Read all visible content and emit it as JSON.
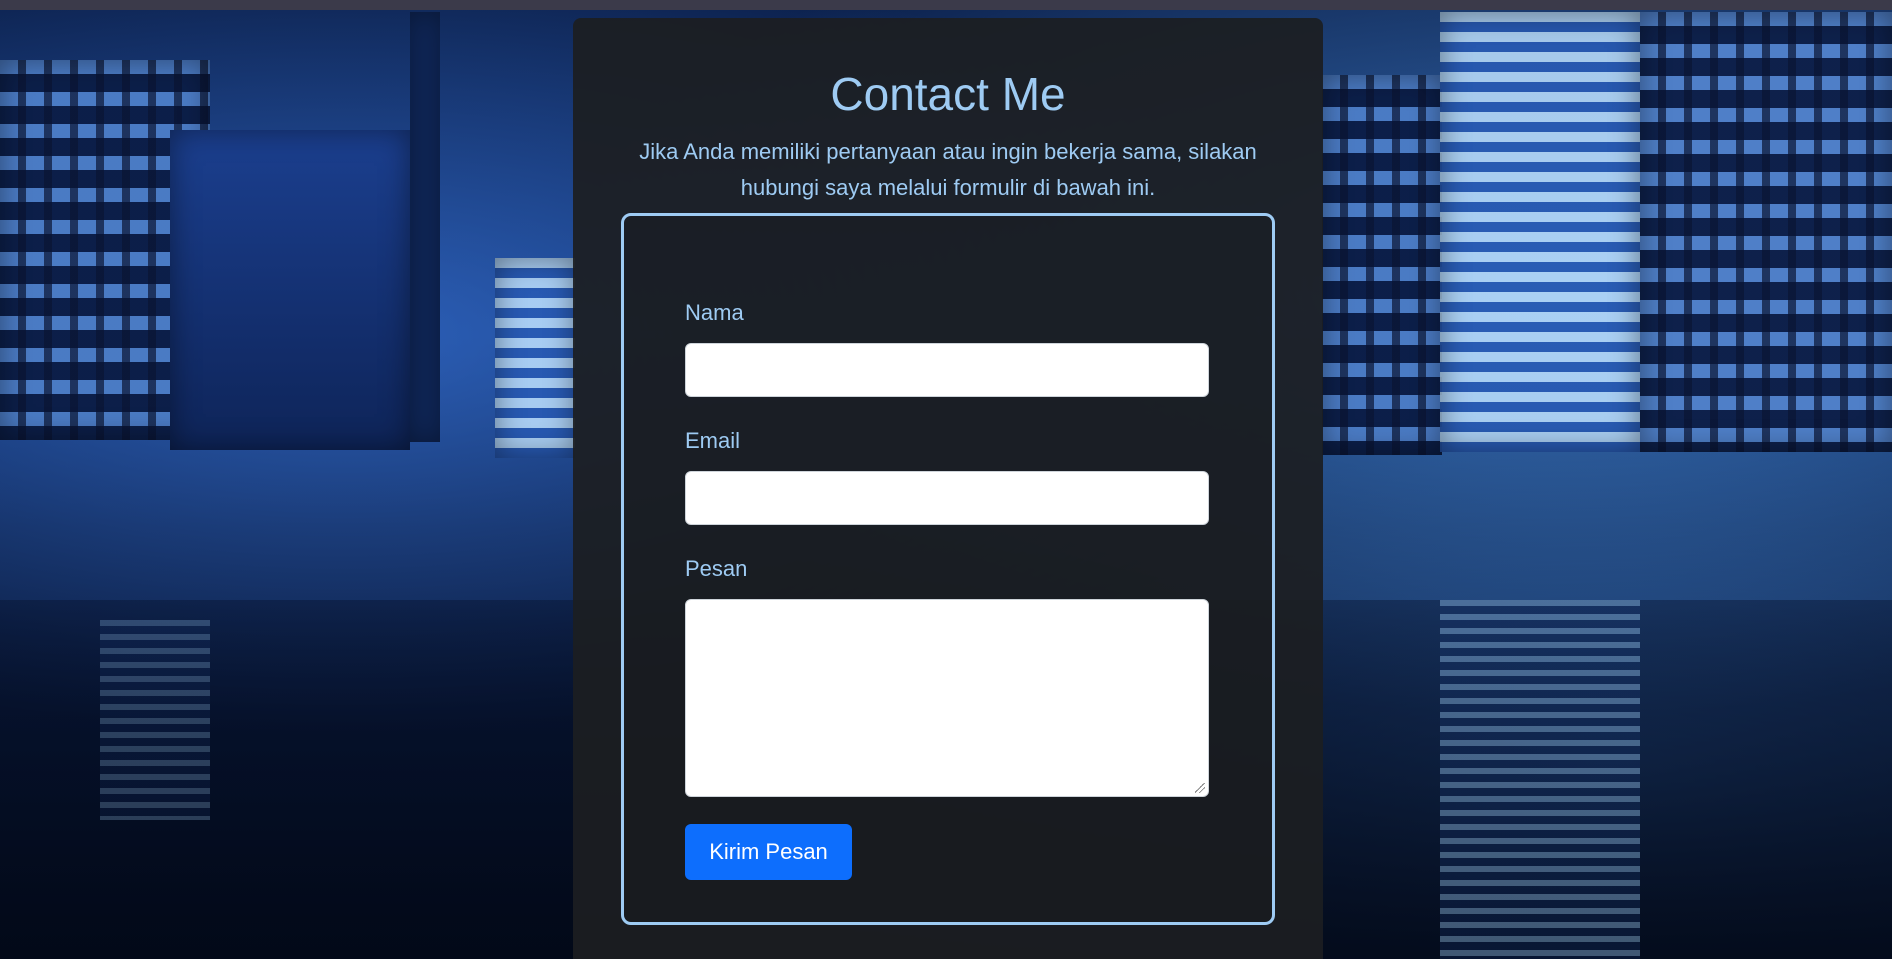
{
  "contact": {
    "title": "Contact Me",
    "subtitle": "Jika Anda memiliki pertanyaan atau ingin bekerja sama, silakan hubungi saya melalui formulir di bawah ini."
  },
  "form": {
    "name_label": "Nama",
    "name_value": "",
    "email_label": "Email",
    "email_value": "",
    "message_label": "Pesan",
    "message_value": "",
    "submit_label": "Kirim Pesan"
  },
  "colors": {
    "accent": "#9ecbf3",
    "button": "#0d6efd",
    "card": "#1c1e21"
  }
}
